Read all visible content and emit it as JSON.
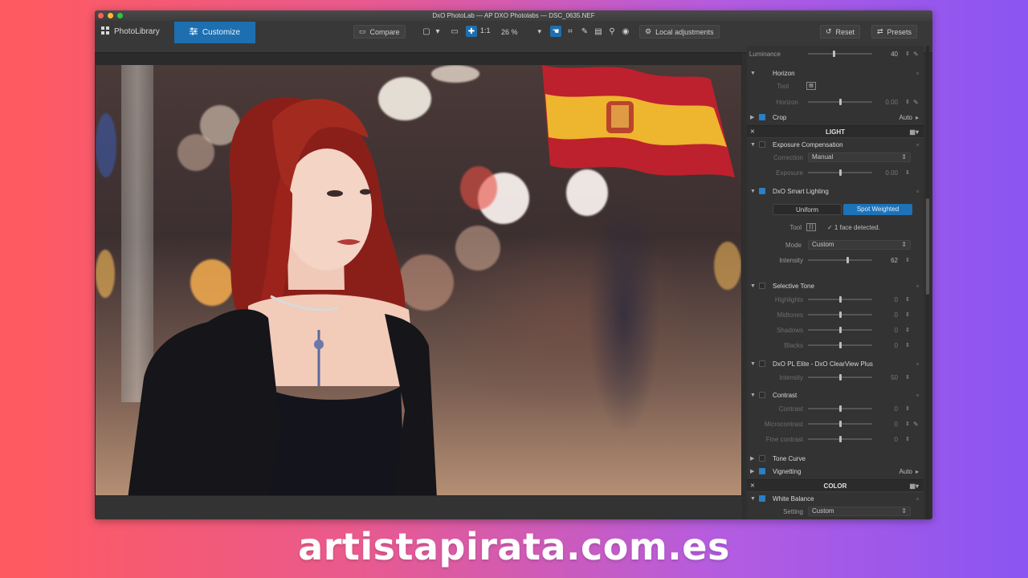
{
  "window": {
    "title": "DxO PhotoLab — AP DXO Photolabs — DSC_0635.NEF"
  },
  "toolbar": {
    "tab_library": "PhotoLibrary",
    "tab_customize": "Customize",
    "compare": "Compare",
    "ratio": "1:1",
    "zoom": "26 %",
    "local_adjustments": "Local adjustments",
    "reset": "Reset",
    "presets": "Presets"
  },
  "panel": {
    "luminance": {
      "label": "Luminance",
      "value": "40"
    },
    "horizon": {
      "title": "Horizon",
      "tool_label": "Tool",
      "label": "Horizon",
      "value": "0.00"
    },
    "crop": {
      "title": "Crop",
      "auto": "Auto"
    },
    "light_header": "LIGHT",
    "exposure": {
      "title": "Exposure Compensation",
      "correction_label": "Correction",
      "correction_value": "Manual",
      "exposure_label": "Exposure",
      "exposure_value": "0.00"
    },
    "smart_lighting": {
      "title": "DxO Smart Lighting",
      "uniform": "Uniform",
      "spot": "Spot Weighted",
      "tool_label": "Tool",
      "faces": "✓ 1 face detected.",
      "mode_label": "Mode",
      "mode_value": "Custom",
      "intensity_label": "Intensity",
      "intensity_value": "62"
    },
    "selective_tone": {
      "title": "Selective Tone",
      "highlights": "Highlights",
      "midtones": "Midtones",
      "shadows": "Shadows",
      "blacks": "Blacks",
      "v1": "0",
      "v2": "0",
      "v3": "0",
      "v4": "0"
    },
    "clearview": {
      "title": "DxO PL Elite - DxO ClearView Plus",
      "intensity_label": "Intensity",
      "intensity_value": "50"
    },
    "contrast": {
      "title": "Contrast",
      "contrast_label": "Contrast",
      "micro_label": "Microcontrast",
      "fine_label": "Fine contrast",
      "v1": "0",
      "v2": "0",
      "v3": "0"
    },
    "tone_curve": {
      "title": "Tone Curve"
    },
    "vignetting": {
      "title": "Vignetting",
      "auto": "Auto"
    },
    "color_header": "COLOR",
    "white_balance": {
      "title": "White Balance",
      "setting_label": "Setting",
      "setting_value": "Custom"
    }
  },
  "sliders": {
    "luminance": 0.4,
    "horizon": 0.5,
    "exposure": 0.5,
    "intensity": 0.62,
    "highlights": 0.5,
    "midtones": 0.5,
    "shadows": 0.5,
    "blacks": 0.5,
    "clearview": 0.5,
    "contrast": 0.5,
    "microcontrast": 0.5,
    "finecontrast": 0.5
  },
  "colors": {
    "accent": "#1d6fb0",
    "flag_red": "#c8202c",
    "flag_yellow": "#f2c230"
  },
  "watermark": "artistapirata.com.es"
}
